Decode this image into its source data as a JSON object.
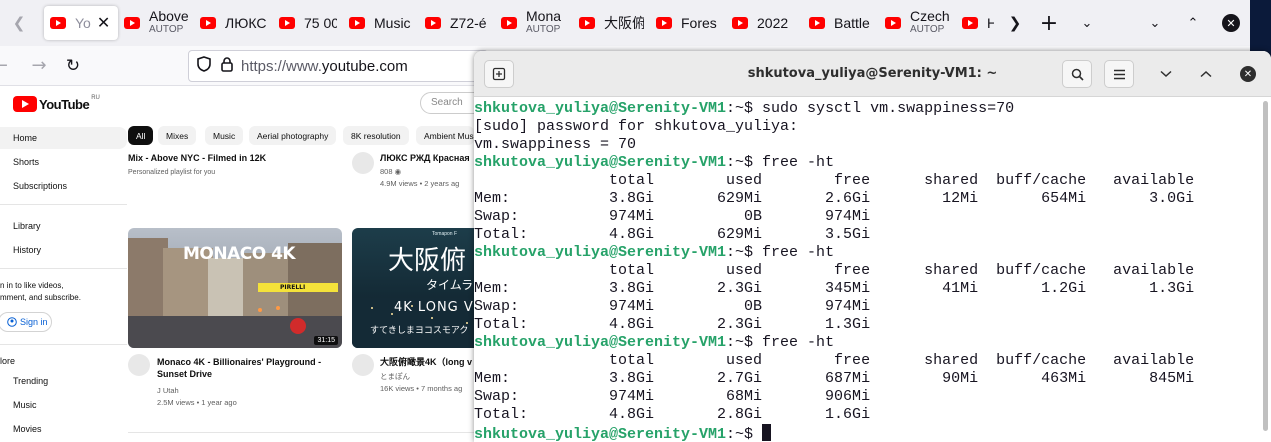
{
  "firefox": {
    "tabs": [
      {
        "title": "Yo",
        "active": true,
        "close": "✕"
      },
      {
        "title": "Above",
        "subtitle": "AUTOP"
      },
      {
        "title": "ЛЮКС"
      },
      {
        "title": "75 00"
      },
      {
        "title": "Music"
      },
      {
        "title": "Z72-é"
      },
      {
        "title": "Mona",
        "subtitle": "AUTOP"
      },
      {
        "title": "大阪俯"
      },
      {
        "title": "Fores"
      },
      {
        "title": "2022"
      },
      {
        "title": "Battle"
      },
      {
        "title": "Czech",
        "subtitle": "AUTOP"
      },
      {
        "title": "HI"
      }
    ],
    "url_prefix": "https://www.",
    "url_domain": "youtube.com"
  },
  "youtube": {
    "logo_text": "YouTube",
    "logo_region": "RU",
    "search_placeholder": "Search",
    "sidebar": {
      "home": "Home",
      "shorts": "Shorts",
      "subscriptions": "Subscriptions",
      "library": "Library",
      "history": "History",
      "signin_note_1": "n in to like videos,",
      "signin_note_2": "mment, and subscribe.",
      "signin_label": "Sign in",
      "explore": "lore",
      "trending": "Trending",
      "music": "Music",
      "movies": "Movies"
    },
    "chips": [
      "All",
      "Mixes",
      "Music",
      "Aerial photography",
      "8K resolution",
      "Ambient Mus"
    ],
    "videos": {
      "v1": {
        "title": "Mix - Above NYC - Filmed in 12K",
        "meta1": "Personalized playlist for you"
      },
      "v2": {
        "title": "ЛЮКС РЖД Красная",
        "meta1": "808 ◉",
        "meta2": "4.9M views • 2 years ag"
      },
      "v3": {
        "title_1": "Monaco 4K - Billionaires' Playground -",
        "title_2": "Sunset Drive",
        "meta1": "J Utah",
        "meta2": "2.5M views • 1 year ago",
        "duration": "31:15",
        "thumb_text": "MONACO 4K",
        "sign": "PIRELLI"
      },
      "v4": {
        "title": "大阪俯瞰景4K（long v",
        "meta1": "とまぽん",
        "meta2": "16K views • 7 months ag",
        "thumb_small": "Tomapon F",
        "thumb_big": "大阪俯",
        "thumb_mid": "タイムラ",
        "thumb_4k": "4K LONG V",
        "thumb_low": "すてきしまヨコスモアク"
      }
    }
  },
  "terminal": {
    "title": "shkutova_yuliya@Serenity-VM1: ~",
    "lines": [
      {
        "prompt": "shkutova_yuliya@Serenity-VM1",
        "rest": ":~$ sudo sysctl vm.swappiness=70"
      },
      {
        "text": "[sudo] password for shkutova_yuliya:"
      },
      {
        "text": "vm.swappiness = 70"
      },
      {
        "prompt": "shkutova_yuliya@Serenity-VM1",
        "rest": ":~$ free -ht"
      },
      {
        "text": "               total        used        free      shared  buff/cache   available"
      },
      {
        "text": "Mem:           3.8Gi       629Mi       2.6Gi        12Mi       654Mi       3.0Gi"
      },
      {
        "text": "Swap:          974Mi          0B       974Mi"
      },
      {
        "text": "Total:         4.8Gi       629Mi       3.5Gi"
      },
      {
        "prompt": "shkutova_yuliya@Serenity-VM1",
        "rest": ":~$ free -ht"
      },
      {
        "text": "               total        used        free      shared  buff/cache   available"
      },
      {
        "text": "Mem:           3.8Gi       2.3Gi       345Mi        41Mi       1.2Gi       1.3Gi"
      },
      {
        "text": "Swap:          974Mi          0B       974Mi"
      },
      {
        "text": "Total:         4.8Gi       2.3Gi       1.3Gi"
      },
      {
        "prompt": "shkutova_yuliya@Serenity-VM1",
        "rest": ":~$ free -ht"
      },
      {
        "text": "               total        used        free      shared  buff/cache   available"
      },
      {
        "text": "Mem:           3.8Gi       2.7Gi       687Mi        90Mi       463Mi       845Mi"
      },
      {
        "text": "Swap:          974Mi        68Mi       906Mi"
      },
      {
        "text": "Total:         4.8Gi       2.8Gi       1.6Gi"
      },
      {
        "prompt": "shkutova_yuliya@Serenity-VM1",
        "rest": ":~$ ",
        "cursor": true
      }
    ]
  }
}
